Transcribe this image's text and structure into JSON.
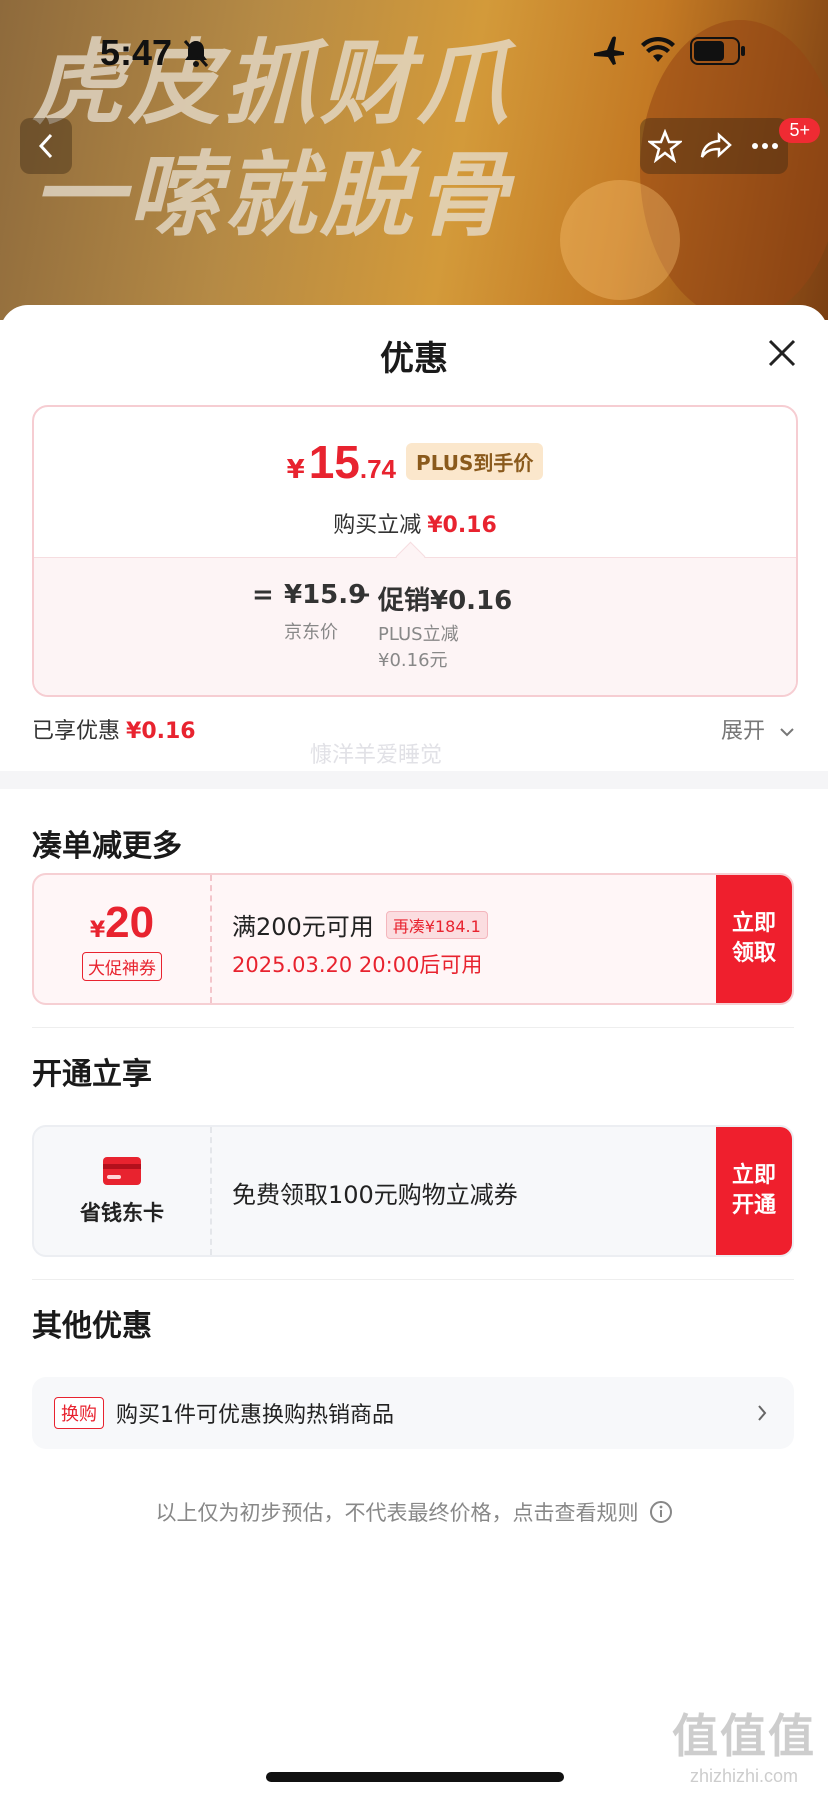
{
  "status_bar": {
    "time": "5:47"
  },
  "banner": {
    "line1": "虎皮抓财爪",
    "line2": "一嗦就脱骨"
  },
  "top_nav": {
    "notification_count": "5+"
  },
  "sheet": {
    "title": "优惠",
    "price": {
      "currency": "¥",
      "main": "15",
      "decimal": ".74",
      "tag": "PLUS到手价",
      "reduce_label": "购买立减",
      "reduce_amount": "¥0.16"
    },
    "calc": {
      "equals": "=",
      "jd_price": "¥15.9",
      "jd_label": "京东价",
      "minus": "−",
      "promo": "促销¥0.16",
      "promo_sub1": "PLUS立减",
      "promo_sub2": "¥0.16元"
    },
    "enjoyed_label": "已享优惠",
    "enjoyed_amount": "¥0.16",
    "expand_label": "展开"
  },
  "section_more": {
    "title": "凑单减更多",
    "coupon": {
      "currency": "¥",
      "amount": "20",
      "type_tag": "大促神券",
      "condition": "满200元可用",
      "extra_tag": "再凑¥184.1",
      "time": "2025.03.20 20:00后可用",
      "button": "立即领取"
    }
  },
  "section_open": {
    "title": "开通立享",
    "card": {
      "name": "省钱东卡",
      "desc": "免费领取100元购物立减券",
      "button": "立即开通"
    }
  },
  "section_other": {
    "title": "其他优惠",
    "item": {
      "tag": "换购",
      "text": "购买1件可优惠换购热销商品"
    }
  },
  "disclaimer": "以上仅为初步预估，不代表最终价格，点击查看规则",
  "watermark": "慷洋羊爱睡觉",
  "corner": {
    "big": "值值值",
    "small": "zhizhizhi.com"
  },
  "colors": {
    "accent_red": "#e8232f",
    "button_red": "#ef1f2d"
  }
}
